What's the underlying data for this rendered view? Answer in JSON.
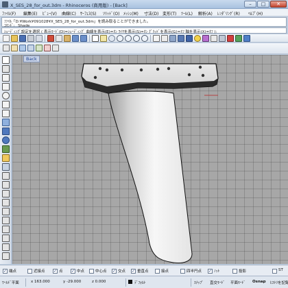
{
  "window": {
    "title": "X_SES_28_for_out.3dm - Rhinoceros (商用版) - [Back]",
    "minimize": "–",
    "maximize": "□",
    "close": "✕"
  },
  "menu": [
    "ﾌｧｲﾙ(F)",
    "編集(E)",
    "ﾋﾞｭｰ(V)",
    "曲線(C)",
    "ｻｰﾌｪｽ(S)",
    "ｿﾘｯﾄﾞ(O)",
    "ﾒｯｼｭ(M)",
    "寸法(D)",
    "変形(T)",
    "ﾂｰﾙ(L)",
    "解析(A)",
    "ﾚﾝﾀﾞﾘﾝｸﾞ(R)",
    "ﾍﾙﾌﾟ(H)"
  ],
  "command_history": [
    "ﾌｧｲﾙ「D:¥Work¥091028¥X_SES_28_for_out.3dm」を読み取ることができました。",
    "ｺﾏﾝﾄﾞ: _Shade"
  ],
  "command_prompt": "ｼｪｰﾃﾞｨﾝｸﾞ設定を選択 ( 表示ﾓｰﾄﾞ(D)=ｼｪｰﾃﾞｨﾝｸﾞ  曲線を表示(E)=ｵﾝ  ﾜｲﾔを表示(S)=ｵﾝ  ｸﾞﾘｯﾄﾞを表示(G)=ｵﾌ  軸を表示(X)=ｵﾌ ):",
  "viewport": {
    "title": "Back"
  },
  "osnap": [
    {
      "label": "端点",
      "checked": true
    },
    {
      "label": "近接点",
      "checked": false
    },
    {
      "label": "点",
      "checked": true
    },
    {
      "label": "中点",
      "checked": true
    },
    {
      "label": "中心点",
      "checked": false
    },
    {
      "label": "交点",
      "checked": true
    },
    {
      "label": "垂直点",
      "checked": true
    },
    {
      "label": "接点",
      "checked": false
    },
    {
      "label": "四半円点",
      "checked": false
    },
    {
      "label": "ﾉｯﾄ",
      "checked": true
    },
    {
      "label": "投影",
      "checked": false
    },
    {
      "label": "ST",
      "checked": false
    }
  ],
  "status": {
    "plane": "ﾜｰﾙﾄﾞ平面",
    "x": "x 163.000",
    "y": "y -29.000",
    "z": "z 0.000",
    "layer": "ﾃﾞﾌｫﾙﾄ",
    "snap": "ｽﾅｯﾌﾟ",
    "ortho": "直交ﾓｰﾄﾞ",
    "planar": "平面ﾓｰﾄﾞ",
    "osnap": "Osnap",
    "record": "ﾋｽﾄﾘを記録"
  }
}
